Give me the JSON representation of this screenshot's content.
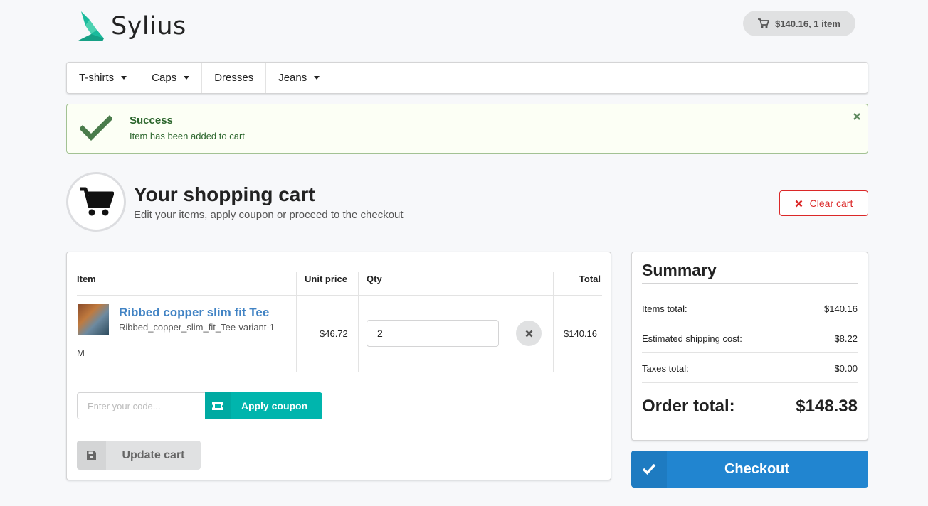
{
  "brand": {
    "name": "Sylius"
  },
  "header": {
    "cart_summary": "$140.16, 1 item"
  },
  "menu": {
    "items": [
      {
        "label": "T-shirts",
        "has_dropdown": true
      },
      {
        "label": "Caps",
        "has_dropdown": true
      },
      {
        "label": "Dresses",
        "has_dropdown": false
      },
      {
        "label": "Jeans",
        "has_dropdown": true
      }
    ]
  },
  "flash": {
    "title": "Success",
    "text": "Item has been added to cart",
    "color": "#2c662d"
  },
  "page": {
    "title": "Your shopping cart",
    "subtitle": "Edit your items, apply coupon or proceed to the checkout",
    "clear_label": "Clear cart"
  },
  "cart_table": {
    "headers": {
      "item": "Item",
      "unit_price": "Unit price",
      "qty": "Qty",
      "total": "Total"
    },
    "row": {
      "name": "Ribbed copper slim fit Tee",
      "variant": "Ribbed_copper_slim_fit_Tee-variant-1",
      "size": "M",
      "unit_price": "$46.72",
      "qty": "2",
      "total": "$140.16"
    }
  },
  "coupon": {
    "placeholder": "Enter your code...",
    "button_label": "Apply coupon"
  },
  "update": {
    "label": "Update cart"
  },
  "summary": {
    "title": "Summary",
    "rows": [
      {
        "label": "Items total:",
        "value": "$140.16"
      },
      {
        "label": "Estimated shipping cost:",
        "value": "$8.22"
      },
      {
        "label": "Taxes total:",
        "value": "$0.00"
      }
    ],
    "order_total_label": "Order total:",
    "order_total_value": "$148.38"
  },
  "checkout": {
    "label": "Checkout"
  },
  "colors": {
    "primary": "#2185d0",
    "teal": "#00b5ad",
    "danger": "#db2828",
    "link": "#4183c4",
    "brand_green": "#1abb9c"
  }
}
